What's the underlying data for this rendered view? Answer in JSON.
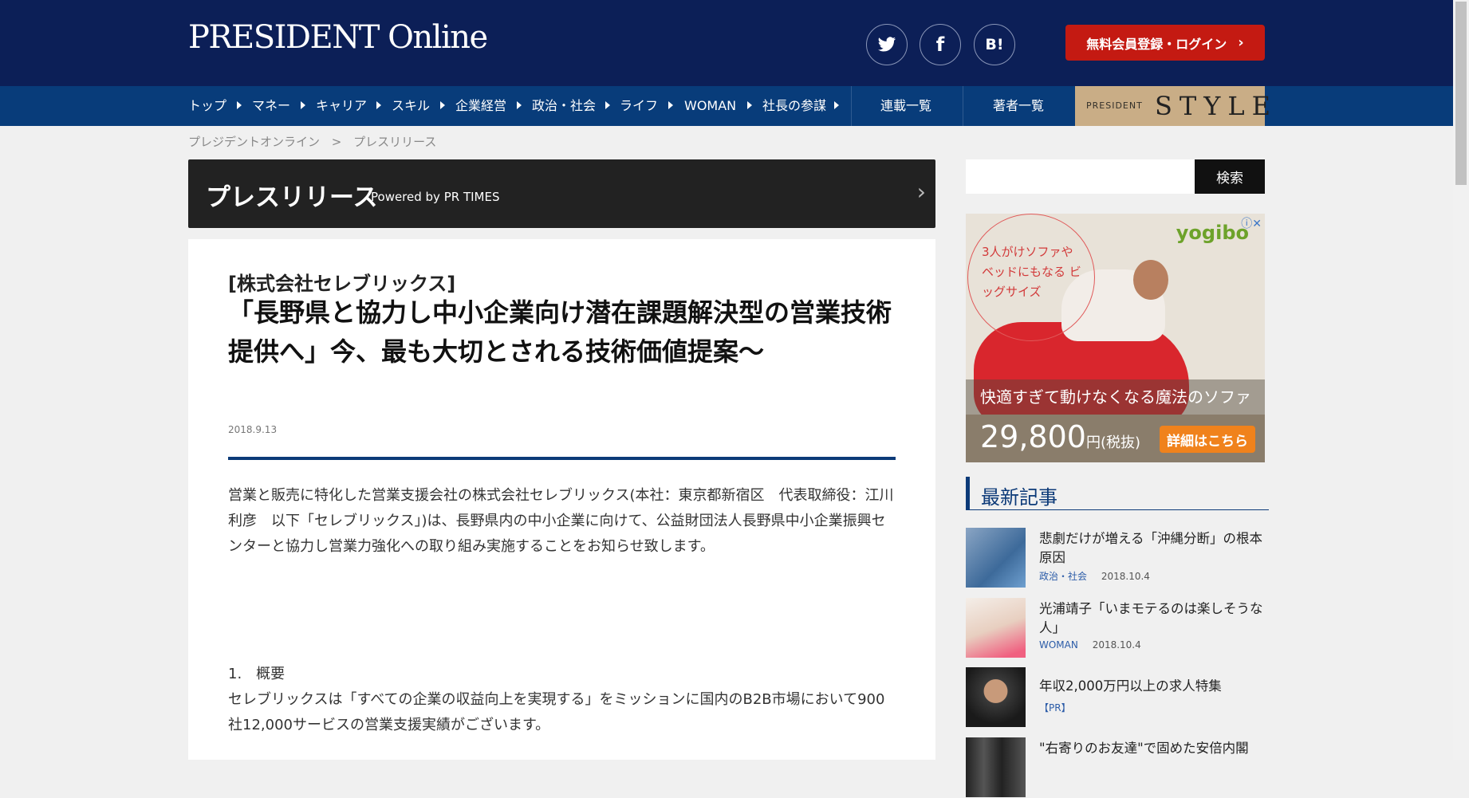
{
  "header": {
    "logo": "PRESIDENT Online",
    "social": [
      {
        "name": "twitter-icon",
        "glyph": "🐦"
      },
      {
        "name": "facebook-icon",
        "glyph": "f"
      },
      {
        "name": "hatena-bookmark-icon",
        "glyph": "B!"
      }
    ],
    "login_label": "無料会員登録・ログイン",
    "login_chevron": "›"
  },
  "nav": {
    "items": [
      "トップ",
      "マネー",
      "キャリア",
      "スキル",
      "企業経営",
      "政治・社会",
      "ライフ",
      "WOMAN",
      "社長の参謀"
    ],
    "serial": "連載一覧",
    "authors": "著者一覧",
    "style_small": "PRESIDENT",
    "style_big": "STYLE"
  },
  "breadcrumb": {
    "home": "プレジデントオンライン",
    "sep": ">",
    "current": "プレスリリース"
  },
  "pressbar": {
    "title": "プレスリリース",
    "powered": "Powered by PR TIMES",
    "chevron": "›"
  },
  "article": {
    "company": "[株式会社セレブリックス]",
    "headline": "「長野県と協力し中小企業向け潜在課題解決型の営業技術提供へ」今、最も大切とされる技術価値提案～",
    "date": "2018.9.13",
    "para1": "営業と販売に特化した営業支援会社の株式会社セレブリックス(本社：東京都新宿区　代表取締役：江川利彦　以下「セレブリックス」)は、長野県内の中小企業に向けて、公益財団法人長野県中小企業振興センターと協力し営業力強化への取り組み実施することをお知らせ致します。",
    "section1": "1.　概要",
    "para2": "セレブリックスは「すべての企業の収益向上を実現する」をミッションに国内のB2B市場において900社12,000サービスの営業支援実績がございます。"
  },
  "sidebar": {
    "search_label": "検索",
    "ad": {
      "circle_text": "3人がけソファや ベッドにもなる ビッグサイズ",
      "logo": "yogibo",
      "tagline": "快適すぎて動けなくなる魔法のソファ",
      "price": "29,800",
      "price_unit": "円(税抜)",
      "cta": "詳細はこちら",
      "close": "ⓘ✕"
    },
    "latest_title": "最新記事",
    "news": [
      {
        "title": "悲劇だけが増える「沖縄分断」の根本原因",
        "category": "政治・社会",
        "date": "2018.10.4"
      },
      {
        "title": "光浦靖子「いまモテるのは楽しそうな人」",
        "category": "WOMAN",
        "date": "2018.10.4"
      },
      {
        "title": "年収2,000万円以上の求人特集",
        "category": "【PR】",
        "date": ""
      },
      {
        "title": "\"右寄りのお友達\"で固めた安倍内閣",
        "category": "",
        "date": ""
      }
    ]
  },
  "colors": {
    "header_bg": "#0c1f57",
    "nav_bg": "#083c7a",
    "login_bg": "#c41a12",
    "accent": "#0c3a78",
    "style_bg": "#c9ad86"
  }
}
